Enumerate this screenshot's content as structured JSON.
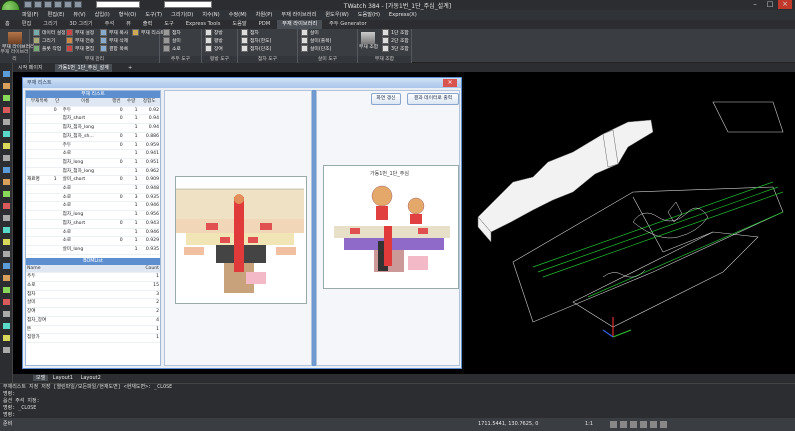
{
  "title": {
    "app": "TWatch 384 - [가동1번_1단_주심_설계]"
  },
  "menu": [
    "파일(F)",
    "편집(E)",
    "뷰(V)",
    "삽입(I)",
    "형식(O)",
    "도구(T)",
    "그리기(D)",
    "치수(N)",
    "수정(M)",
    "차원(P)",
    "부재 라이브러리",
    "윈도우(W)",
    "도움말(H)",
    "Express(X)"
  ],
  "ribbon_tabs": [
    "홈",
    "편집",
    "그리기",
    "3D 그리기",
    "주석",
    "뷰",
    "출력",
    "도구",
    "Express Tools",
    "도움말",
    "PDM",
    "부재 라이브러리",
    "주두 Generator"
  ],
  "ribbon_active": "부재 라이브러리",
  "ribbon": {
    "groups": [
      {
        "label": "부재 라이브러리",
        "items": [
          "부재 라이브러리"
        ]
      },
      {
        "label": "부재 관리",
        "items": [
          "데이터 설정",
          "그리기",
          "플롯 작업",
          "부재 설정",
          "부재 전송",
          "부재 편집",
          "부재 복사",
          "부재 삭제",
          "결합 목록",
          "부재 리스트"
        ]
      },
      {
        "label": "주두 도구",
        "items": [
          "첨차",
          "살미",
          "소로"
        ]
      },
      {
        "label": "평방 도구",
        "items": [
          "창방",
          "평방",
          "장여"
        ]
      },
      {
        "label": "첨차 도구",
        "items": [
          "첨차",
          "첨차(한도)",
          "첨차(단조)"
        ]
      },
      {
        "label": "살미 도구",
        "items": [
          "살미",
          "살미(출목)",
          "살미(단조)"
        ]
      },
      {
        "label": "부재 조합",
        "items": [
          "부재 조합",
          "1단 조합",
          "2단 조합",
          "3단 조합"
        ]
      }
    ]
  },
  "doc_tabs": [
    "시작 페이지",
    "가동1번_1단_주심_설계",
    "+"
  ],
  "dialog": {
    "title": "부재 리스트",
    "panel_header": "부재 리스트",
    "columns": [
      "부재목록",
      "단",
      "이름",
      "행번",
      "수량",
      "정합도"
    ],
    "group_label": "재료명",
    "rows": [
      {
        "dan": "0",
        "name": "주두",
        "row": "0",
        "qty": "1",
        "fit": "0.92"
      },
      {
        "dan": "",
        "name": "첨차_short",
        "row": "0",
        "qty": "1",
        "fit": "0.94"
      },
      {
        "dan": "",
        "name": "첨차_첨차_long",
        "row": "",
        "qty": "1",
        "fit": "0.94"
      },
      {
        "dan": "",
        "name": "첨차_첨차_sh...",
        "row": "0",
        "qty": "1",
        "fit": "0.886"
      },
      {
        "dan": "",
        "name": "주두",
        "row": "0",
        "qty": "1",
        "fit": "0.959"
      },
      {
        "dan": "",
        "name": "소로",
        "row": "",
        "qty": "1",
        "fit": "0.941"
      },
      {
        "dan": "",
        "name": "첨차_long",
        "row": "0",
        "qty": "1",
        "fit": "0.951"
      },
      {
        "dan": "",
        "name": "첨차_첨차_long",
        "row": "",
        "qty": "1",
        "fit": "0.962"
      },
      {
        "dan": "1",
        "name": "살미_short",
        "row": "0",
        "qty": "1",
        "fit": "0.909"
      },
      {
        "dan": "",
        "name": "소로",
        "row": "",
        "qty": "1",
        "fit": "0.948"
      },
      {
        "dan": "",
        "name": "소로",
        "row": "0",
        "qty": "3",
        "fit": "0.935"
      },
      {
        "dan": "",
        "name": "소로",
        "row": "",
        "qty": "1",
        "fit": "0.946"
      },
      {
        "dan": "",
        "name": "첨차_long",
        "row": "",
        "qty": "1",
        "fit": "0.956"
      },
      {
        "dan": "",
        "name": "첨차_short",
        "row": "0",
        "qty": "1",
        "fit": "0.943"
      },
      {
        "dan": "",
        "name": "소로",
        "row": "",
        "qty": "1",
        "fit": "0.946"
      },
      {
        "dan": "",
        "name": "소로",
        "row": "0",
        "qty": "1",
        "fit": "0.929"
      },
      {
        "dan": "",
        "name": "살미_long",
        "row": "",
        "qty": "1",
        "fit": "0.935"
      }
    ],
    "bom_header": "BOMList",
    "bom_columns": [
      "Name",
      "Count"
    ],
    "bom_rows": [
      {
        "name": "주두",
        "count": "1"
      },
      {
        "name": "소로",
        "count": "15"
      },
      {
        "name": "첨차",
        "count": "3"
      },
      {
        "name": "살미",
        "count": "2"
      },
      {
        "name": "장여",
        "count": "2"
      },
      {
        "name": "첨차_장여",
        "count": "4"
      },
      {
        "name": "뜬",
        "count": "1"
      },
      {
        "name": "첨항가",
        "count": "1"
      }
    ],
    "buttons": {
      "refresh": "화면 갱신",
      "export": "결과 데이터로 출력"
    },
    "view_title": "가동1번_1단_주심"
  },
  "layout_tabs": [
    "모델",
    "Layout1",
    "Layout2"
  ],
  "command_lines": [
    "부재리스트 지정 저장 [열린파일/모든파일/현재도면] <현재도면>: _CLOSE",
    "명령:",
    "옵션 주석 지정:",
    "명령: _CLOSE",
    "명령:"
  ],
  "status": {
    "left": "준비",
    "coords": "1711.5441, 130.7625, 0",
    "scale": "1:1"
  },
  "colors": {
    "accent": "#5d8fd0",
    "cad_bg": "#000000",
    "ribbon": "#3a3d42"
  }
}
